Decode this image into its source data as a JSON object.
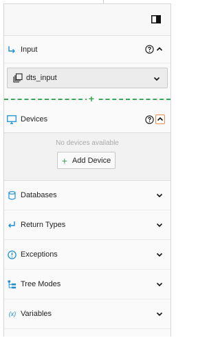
{
  "sections": {
    "input": {
      "label": "Input",
      "selected": "dts_input"
    },
    "devices": {
      "label": "Devices",
      "empty_text": "No devices available",
      "add_button_label": "Add Device"
    },
    "databases": {
      "label": "Databases"
    },
    "return_types": {
      "label": "Return Types"
    },
    "exceptions": {
      "label": "Exceptions"
    },
    "tree_modes": {
      "label": "Tree Modes"
    },
    "variables": {
      "label": "Variables",
      "icon_text": "(x)"
    }
  },
  "colors": {
    "accent": "#1a8fd6",
    "green": "#3aa757",
    "focus_orange": "#f08a4b"
  },
  "icons": {
    "collapse": "panel-collapse-icon",
    "input": "input-arrow-icon",
    "devices": "monitor-icon",
    "databases": "database-icon",
    "return_types": "return-arrow-icon",
    "exceptions": "exclamation-circle-icon",
    "tree_modes": "tree-icon",
    "variables": "variable-icon"
  }
}
